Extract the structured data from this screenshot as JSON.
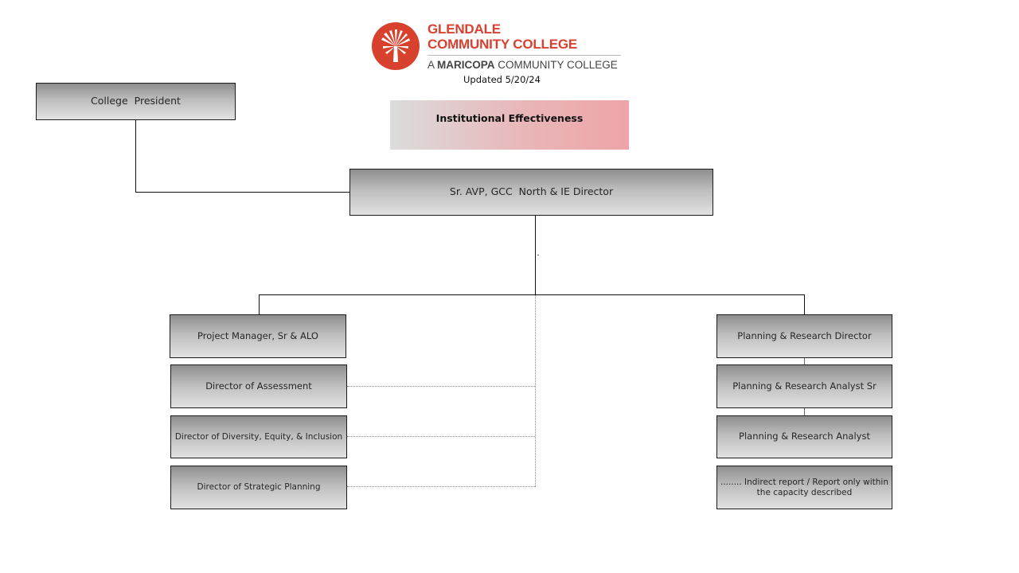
{
  "header": {
    "logo": {
      "icon": "palm-tree-icon",
      "name_line1": "GLENDALE",
      "name_line2": "COMMUNITY COLLEGE",
      "sub_prefix": "A ",
      "sub_bold": "MARICOPA",
      "sub_suffix": " COMMUNITY COLLEGE",
      "brand_color": "#d9412f"
    },
    "updated": "Updated 5/20/24",
    "department": "Institutional Effectiveness"
  },
  "org_chart": {
    "president": "College  President",
    "director": "Sr. AVP, GCC  North & IE Director",
    "left_column": [
      {
        "title": "Project Manager, Sr & ALO",
        "report_type": "direct"
      },
      {
        "title": "Director of Assessment",
        "report_type": "indirect"
      },
      {
        "title": "Director of Diversity, Equity, & Inclusion",
        "report_type": "indirect"
      },
      {
        "title": "Director of Strategic Planning",
        "report_type": "indirect"
      }
    ],
    "right_column": [
      {
        "title": "Planning & Research Director",
        "report_type": "direct"
      },
      {
        "title": "Planning & Research Analyst Sr",
        "report_type": "chain"
      },
      {
        "title": "Planning & Research Analyst",
        "report_type": "chain"
      }
    ],
    "legend": {
      "line1": "........ Indirect report / Report only within",
      "line2": "the capacity described"
    }
  }
}
